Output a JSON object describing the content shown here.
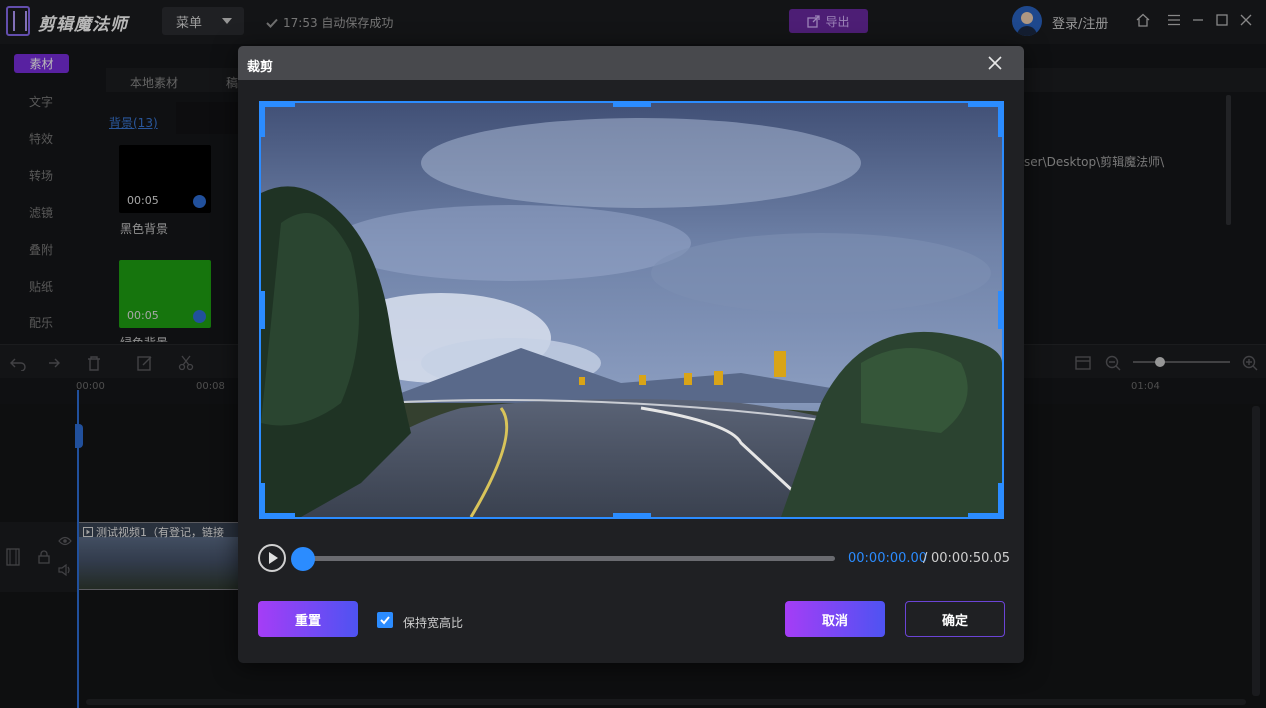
{
  "app": {
    "name": "剪辑魔法师",
    "menu_label": "菜单",
    "save_status": "17:53 自动保存成功",
    "export_label": "导出",
    "login_label": "登录/注册"
  },
  "left_nav": {
    "active_tab": "素材",
    "items": [
      "文字",
      "特效",
      "转场",
      "滤镜",
      "叠附",
      "贴纸",
      "配乐"
    ]
  },
  "media": {
    "tabs": [
      "本地素材",
      "稿"
    ],
    "category_link": "背景(13)",
    "thumbnails": [
      {
        "duration": "00:05",
        "label": "黑色背景",
        "color": "#000000"
      },
      {
        "duration": "00:05",
        "label": "绿色背景",
        "color": "#1fa313"
      }
    ],
    "path_text": "ser\\Desktop\\剪辑魔法师\\"
  },
  "timeline": {
    "ruler_labels": [
      "00:00",
      "00:08",
      "01:04"
    ],
    "clip_title": "测试视频1（有登记，链接"
  },
  "dialog": {
    "title": "裁剪",
    "time_current": "00:00:00.00",
    "time_separator": "/",
    "time_total": "00:00:50.05",
    "progress": 0,
    "reset_label": "重置",
    "keep_ratio_label": "保持宽高比",
    "keep_ratio_checked": true,
    "cancel_label": "取消",
    "confirm_label": "确定"
  },
  "colors": {
    "accent_blue": "#2b8cff",
    "accent_purple": "#7a2ee0",
    "dialog_bg": "#1f2023"
  }
}
